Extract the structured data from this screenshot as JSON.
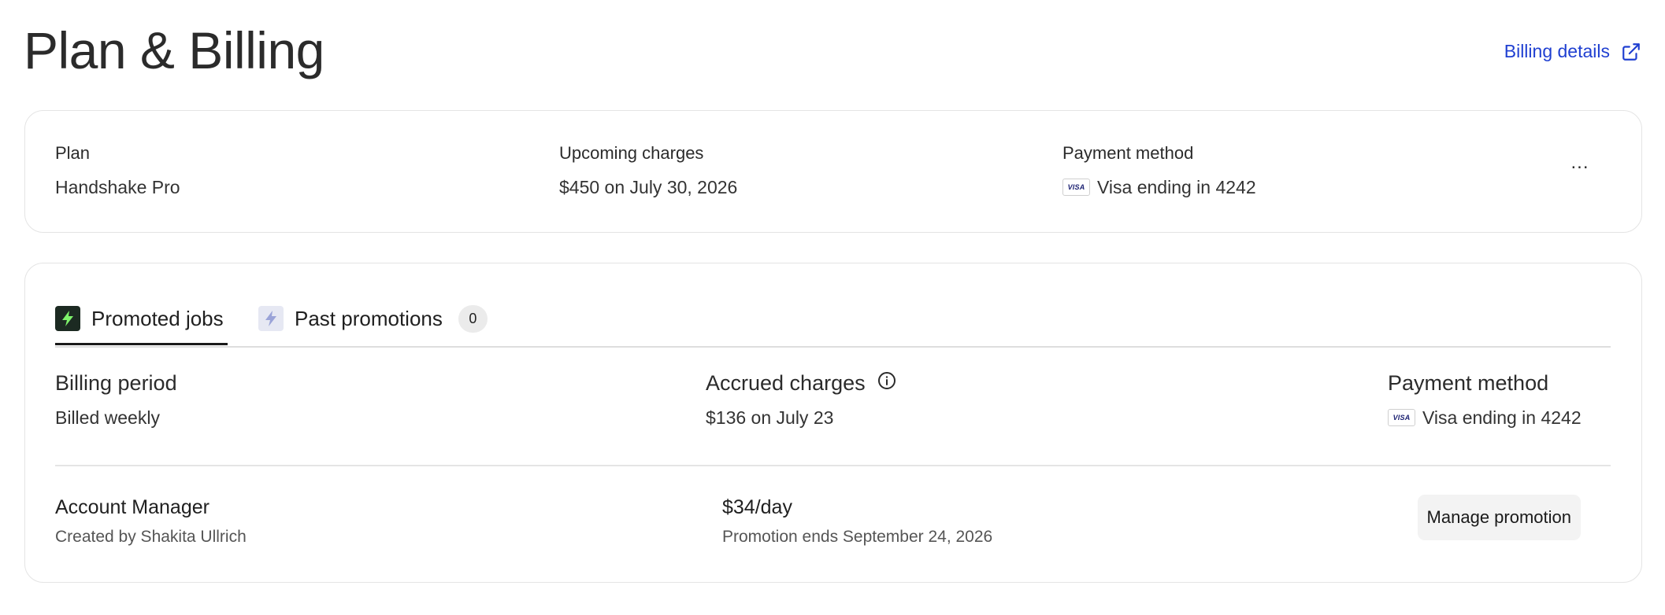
{
  "header": {
    "title": "Plan & Billing",
    "billing_details_label": "Billing details"
  },
  "plan_card": {
    "plan_label": "Plan",
    "plan_value": "Handshake Pro",
    "upcoming_label": "Upcoming charges",
    "upcoming_value": "$450 on July 30, 2026",
    "payment_label": "Payment method",
    "payment_card_brand": "VISA",
    "payment_value": "Visa ending in 4242",
    "more_label": "..."
  },
  "promo_card": {
    "tabs": [
      {
        "label": "Promoted jobs",
        "icon": "lightning-icon",
        "active": true
      },
      {
        "label": "Past promotions",
        "icon": "lightning-icon",
        "count": "0",
        "active": false
      }
    ],
    "billing_period_label": "Billing period",
    "billing_period_value": "Billed weekly",
    "accrued_label": "Accrued charges",
    "accrued_value": "$136 on July 23",
    "payment_label": "Payment method",
    "payment_card_brand": "VISA",
    "payment_value": "Visa ending in 4242",
    "job": {
      "title": "Account Manager",
      "created_by": "Created by Shakita Ullrich",
      "rate": "$34/day",
      "ends": "Promotion ends September 24, 2026",
      "manage_label": "Manage promotion"
    }
  },
  "colors": {
    "link": "#1f3fd1",
    "active_tab_icon_bg": "#1c2a22",
    "active_tab_icon_fg": "#7ef36b",
    "inactive_tab_icon_bg": "#e6e8f3",
    "inactive_tab_icon_fg": "#9aa3d8"
  }
}
